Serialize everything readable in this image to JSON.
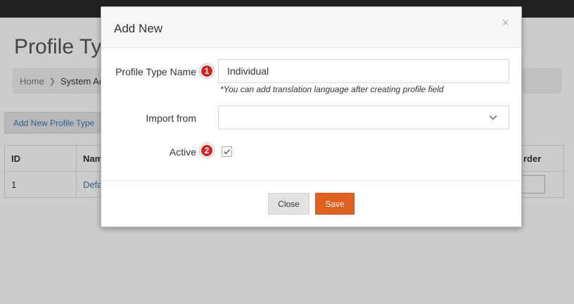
{
  "page": {
    "title": "Profile Typ",
    "breadcrumb": {
      "home": "Home",
      "current": "System Ac"
    },
    "add_button": "Add New Profile Type",
    "table": {
      "headers": [
        "ID",
        "Nam",
        "rder"
      ],
      "rows": [
        {
          "id": "1",
          "name": "Defa"
        }
      ]
    }
  },
  "modal": {
    "title": "Add New",
    "close_symbol": "×",
    "fields": {
      "profile_type_name": {
        "label": "Profile Type Name",
        "badge": "1",
        "value": "Individual",
        "hint": "*You can add translation language after creating profile field"
      },
      "import_from": {
        "label": "Import from",
        "value": ""
      },
      "active": {
        "label": "Active",
        "badge": "2",
        "checked": true
      }
    },
    "footer": {
      "close_label": "Close",
      "save_label": "Save"
    }
  },
  "colors": {
    "accent": "#e0601e",
    "badge": "#d9211d",
    "link": "#3b78b6",
    "topbar": "#2b2b2b"
  },
  "icons": {
    "close": "close-icon",
    "chevron": "chevron-down-icon",
    "check": "check-icon"
  }
}
